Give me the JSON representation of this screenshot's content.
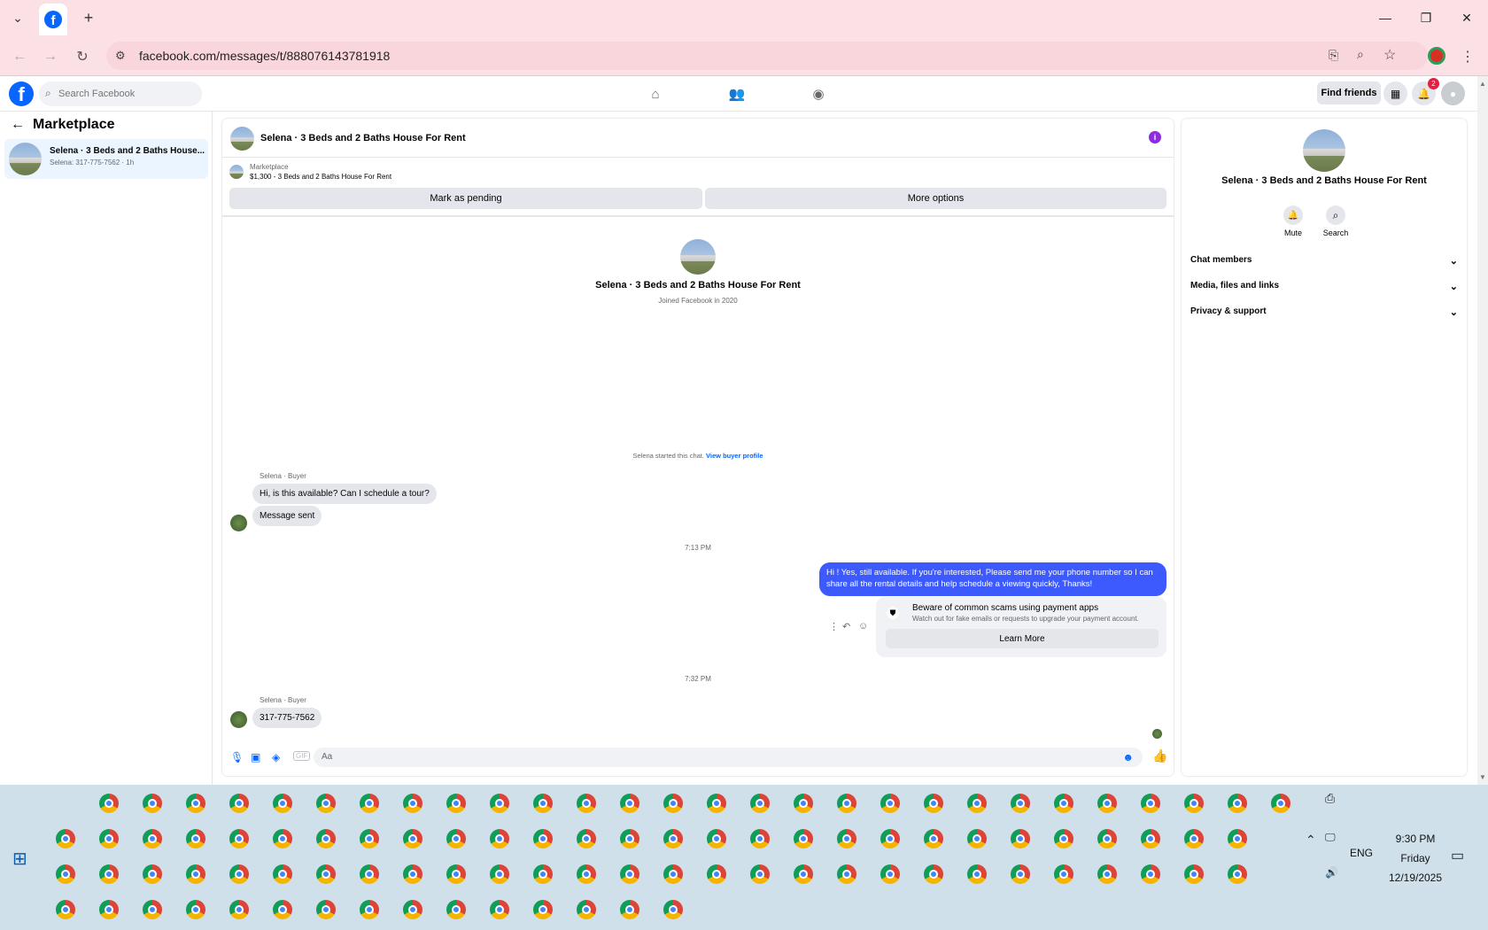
{
  "browser": {
    "url": "facebook.com/messages/t/888076143781918",
    "icons": [
      "tab-list-icon",
      "facebook-favicon",
      "new-tab-icon",
      "minimize-icon",
      "restore-icon",
      "close-icon",
      "back-icon",
      "forward-icon",
      "reload-icon",
      "site-info-icon",
      "install-icon",
      "zoom-icon",
      "bookmark-star-icon",
      "profile-icon",
      "menu-icon"
    ]
  },
  "facebook_header": {
    "search_placeholder": "Search Facebook",
    "find_friends": "Find friends",
    "notification_count": "2"
  },
  "sidebar": {
    "title": "Marketplace",
    "conversation": {
      "title": "Selena · 3 Beds and 2 Baths House...",
      "subtitle": "Selena: 317-775-7562 · 1h"
    }
  },
  "chat": {
    "header_title": "Selena · 3 Beds and 2 Baths House For Rent",
    "listing": {
      "category": "Marketplace",
      "price_title": "$1,300 - 3 Beds and 2 Baths House For Rent"
    },
    "buttons": {
      "mark_pending": "Mark as pending",
      "more_options": "More options"
    },
    "profile": {
      "name": "Selena · 3 Beds and 2 Baths House For Rent",
      "joined": "Joined Facebook in 2020"
    },
    "started_text": "Selena started this chat.",
    "view_buyer_profile": "View buyer profile",
    "messages": [
      {
        "sender": "Selena · Buyer",
        "text": "Hi, is this available? Can I schedule a tour?"
      },
      {
        "text": "Message sent"
      },
      {
        "timestamp": "7:13 PM"
      },
      {
        "text": "Hi ! Yes, still available. If you're interested, Please send me your phone number so I can share all the rental details and help schedule a viewing quickly, Thanks!"
      },
      {
        "timestamp": "7:32 PM"
      },
      {
        "sender": "Selena · Buyer",
        "text": "317-775-7562"
      }
    ],
    "scam_notice": {
      "title": "Beware of common scams using payment apps",
      "body": "Watch out for fake emails or requests to upgrade your payment account.",
      "button": "Learn More"
    },
    "composer_placeholder": "Aa"
  },
  "info_panel": {
    "title": "Selena · 3 Beds and 2 Baths House For Rent",
    "mute": "Mute",
    "search": "Search",
    "sections": [
      "Chat members",
      "Media, files and links",
      "Privacy & support"
    ]
  },
  "taskbar": {
    "time": "9:30 PM",
    "day": "Friday",
    "date": "12/19/2025",
    "language": "ENG"
  },
  "colors": {
    "tab_bar": "#fbe0e5",
    "facebook_blue": "#0866ff",
    "outgoing_bubble": "#3d5afe",
    "taskbar": "#cfe0ea"
  }
}
